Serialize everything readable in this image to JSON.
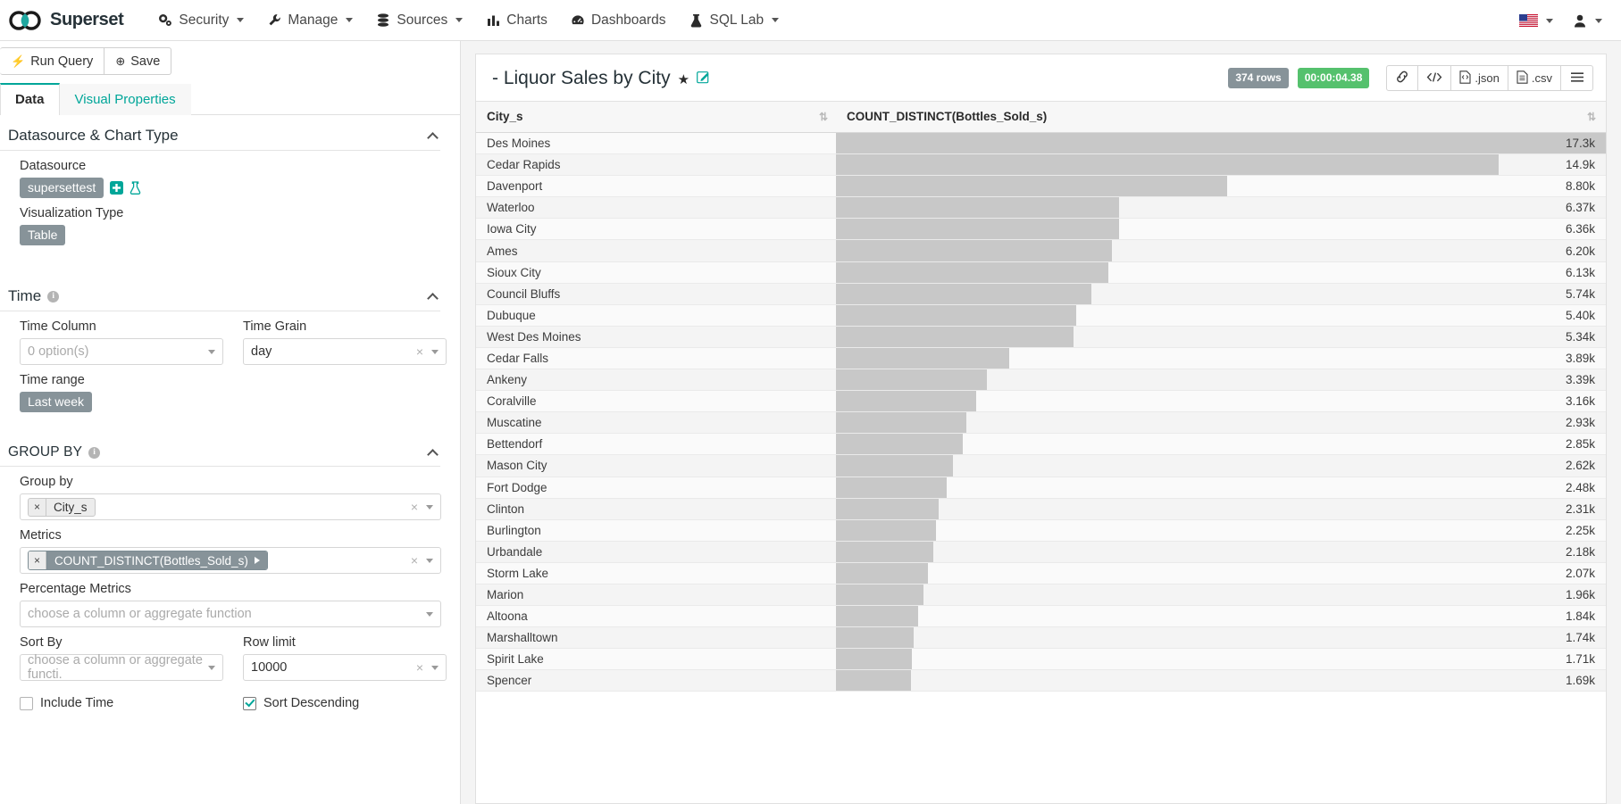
{
  "navbar": {
    "brand": "Superset",
    "items": [
      {
        "label": "Security",
        "icon": "gears-icon",
        "caret": true
      },
      {
        "label": "Manage",
        "icon": "wrench-icon",
        "caret": true
      },
      {
        "label": "Sources",
        "icon": "database-icon",
        "caret": true
      },
      {
        "label": "Charts",
        "icon": "bar-chart-icon",
        "caret": false
      },
      {
        "label": "Dashboards",
        "icon": "dashboard-icon",
        "caret": false
      },
      {
        "label": "SQL Lab",
        "icon": "flask-icon",
        "caret": true
      }
    ],
    "language": "en-US flag",
    "user": "user-icon"
  },
  "query_bar": {
    "run_label": "Run Query",
    "save_label": "Save"
  },
  "tabs": [
    {
      "label": "Data",
      "active": true
    },
    {
      "label": "Visual Properties",
      "active": false
    }
  ],
  "sections": {
    "datasource": {
      "title": "Datasource & Chart Type",
      "datasource_label": "Datasource",
      "datasource_value": "supersettest",
      "viz_label": "Visualization Type",
      "viz_value": "Table"
    },
    "time": {
      "title": "Time",
      "time_column_label": "Time Column",
      "time_column_placeholder": "0 option(s)",
      "time_grain_label": "Time Grain",
      "time_grain_value": "day",
      "time_range_label": "Time range",
      "time_range_value": "Last week"
    },
    "group_by": {
      "title": "GROUP BY",
      "group_by_label": "Group by",
      "group_by_value": "City_s",
      "metrics_label": "Metrics",
      "metrics_value": "COUNT_DISTINCT(Bottles_Sold_s)",
      "percentage_metrics_label": "Percentage Metrics",
      "percentage_metrics_placeholder": "choose a column or aggregate function",
      "sort_by_label": "Sort By",
      "sort_by_placeholder": "choose a column or aggregate functi.",
      "row_limit_label": "Row limit",
      "row_limit_value": "10000",
      "include_time_label": "Include Time",
      "include_time_checked": false,
      "sort_descending_label": "Sort Descending",
      "sort_descending_checked": true
    }
  },
  "chart": {
    "title": "- Liquor Sales by City",
    "favorite_icon": "star-icon",
    "edit_icon": "edit-icon",
    "rows_badge": "374 rows",
    "time_badge": "00:00:04.38",
    "actions": [
      {
        "name": "share-link-button",
        "label": "",
        "icon": "chain-icon"
      },
      {
        "name": "view-query-button",
        "label": "",
        "icon": "code-icon"
      },
      {
        "name": "export-json-button",
        "label": ".json",
        "icon": "file-json-icon"
      },
      {
        "name": "export-csv-button",
        "label": ".csv",
        "icon": "file-csv-icon"
      },
      {
        "name": "more-menu-button",
        "label": "",
        "icon": "hamburger-icon"
      }
    ]
  },
  "colors": {
    "accent": "#00a699",
    "pill": "#879399",
    "badge_rows": "#879399",
    "badge_time": "#55c16d",
    "bar": "#c8c8c8"
  },
  "chart_data": {
    "type": "bar",
    "title": "- Liquor Sales by City",
    "columns": [
      "City_s",
      "COUNT_DISTINCT(Bottles_Sold_s)"
    ],
    "xlabel": "City_s",
    "ylabel": "COUNT_DISTINCT(Bottles_Sold_s)",
    "grid": false,
    "legend": "none",
    "max_value": 17300,
    "categories": [
      "Des Moines",
      "Cedar Rapids",
      "Davenport",
      "Waterloo",
      "Iowa City",
      "Ames",
      "Sioux City",
      "Council Bluffs",
      "Dubuque",
      "West Des Moines",
      "Cedar Falls",
      "Ankeny",
      "Coralville",
      "Muscatine",
      "Bettendorf",
      "Mason City",
      "Fort Dodge",
      "Clinton",
      "Burlington",
      "Urbandale",
      "Storm Lake",
      "Marion",
      "Altoona",
      "Marshalltown",
      "Spirit Lake",
      "Spencer"
    ],
    "values": [
      17300,
      14900,
      8800,
      6370,
      6360,
      6200,
      6130,
      5740,
      5400,
      5340,
      3890,
      3390,
      3160,
      2930,
      2850,
      2620,
      2480,
      2310,
      2250,
      2180,
      2070,
      1960,
      1840,
      1740,
      1710,
      1690
    ],
    "labels": [
      "17.3k",
      "14.9k",
      "8.80k",
      "6.37k",
      "6.36k",
      "6.20k",
      "6.13k",
      "5.74k",
      "5.40k",
      "5.34k",
      "3.89k",
      "3.39k",
      "3.16k",
      "2.93k",
      "2.85k",
      "2.62k",
      "2.48k",
      "2.31k",
      "2.25k",
      "2.18k",
      "2.07k",
      "1.96k",
      "1.84k",
      "1.74k",
      "1.71k",
      "1.69k"
    ]
  }
}
